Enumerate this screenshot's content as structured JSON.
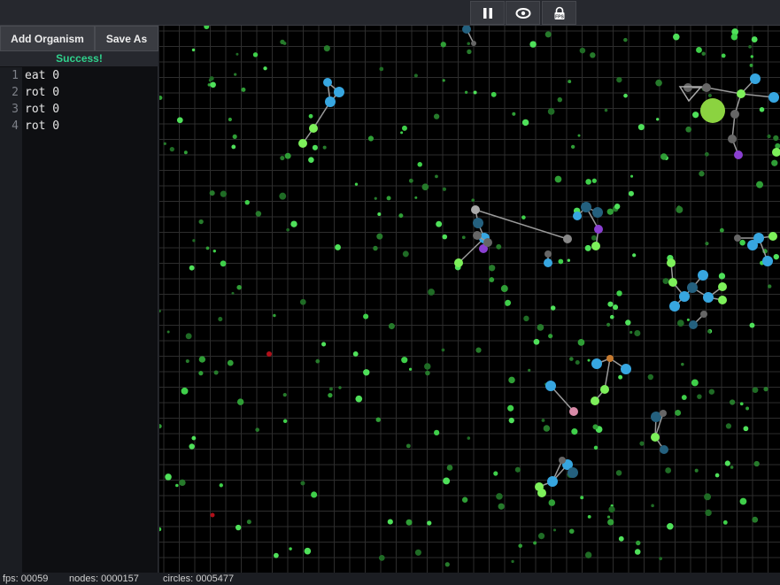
{
  "toolbar": {
    "pause_icon": "pause-icon",
    "eye_icon": "eye-icon",
    "fps_icon": "fps-lock-icon",
    "fps_icon_text": "FPS"
  },
  "sidebar": {
    "add_label": "Add Organism",
    "save_label": "Save As",
    "status": "Success!",
    "status_color": "#2fd18c",
    "lines": [
      {
        "num": "1",
        "code": "eat 0"
      },
      {
        "num": "2",
        "code": "rot 0"
      },
      {
        "num": "3",
        "code": "rot 0"
      },
      {
        "num": "4",
        "code": "rot 0"
      }
    ]
  },
  "footer": {
    "fps": "fps: 00059",
    "nodes": "nodes: 0000157",
    "circles": "circles: 0005477"
  },
  "colors": {
    "background": "#000000",
    "grid": "#2d2d2d",
    "food_green": "#3fcf4a",
    "node_blue": "#37a6e0",
    "big_circle": "#8bd340"
  }
}
